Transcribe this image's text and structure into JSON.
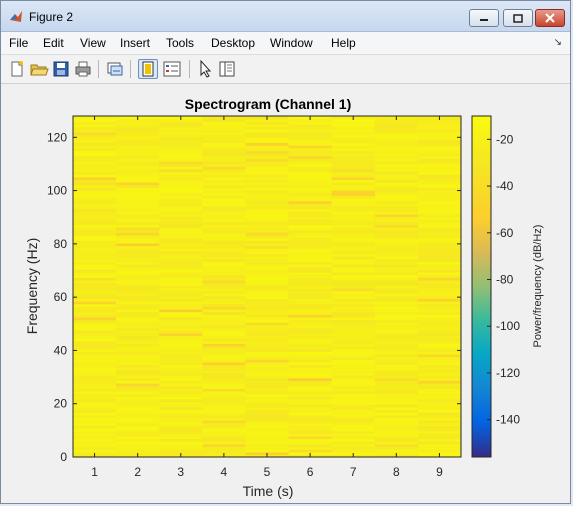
{
  "window": {
    "title": "Figure 2"
  },
  "menu": [
    "File",
    "Edit",
    "View",
    "Insert",
    "Tools",
    "Desktop",
    "Window",
    "Help"
  ],
  "toolbar": {
    "icons": [
      "new-figure-icon",
      "open-file-icon",
      "save-icon",
      "print-icon",
      "link-plot-icon",
      "hide-plot-tools-icon",
      "show-plot-tools-icon",
      "edit-plot-icon",
      "plot-browser-icon"
    ]
  },
  "colors": {
    "window_bg": "#f0f0f0",
    "accent": "#6b8fc2"
  },
  "chart_data": {
    "type": "heatmap",
    "title": "Spectrogram (Channel 1)",
    "xlabel": "Time (s)",
    "ylabel": "Frequency (Hz)",
    "colorbar_label": "Power/frequency (dB/Hz)",
    "colormap": "parula",
    "x_ticks": [
      1,
      2,
      3,
      4,
      5,
      6,
      7,
      8,
      9
    ],
    "y_ticks": [
      0,
      20,
      40,
      60,
      80,
      100,
      120
    ],
    "xlim": [
      0.5,
      9.5
    ],
    "ylim": [
      0,
      128
    ],
    "clim": [
      -156,
      -10
    ],
    "colorbar_ticks": [
      -20,
      -40,
      -60,
      -80,
      -100,
      -120,
      -140
    ],
    "time_columns": 9,
    "frequency_bins": 129,
    "typical_power_range_db": [
      -30,
      -15
    ]
  }
}
